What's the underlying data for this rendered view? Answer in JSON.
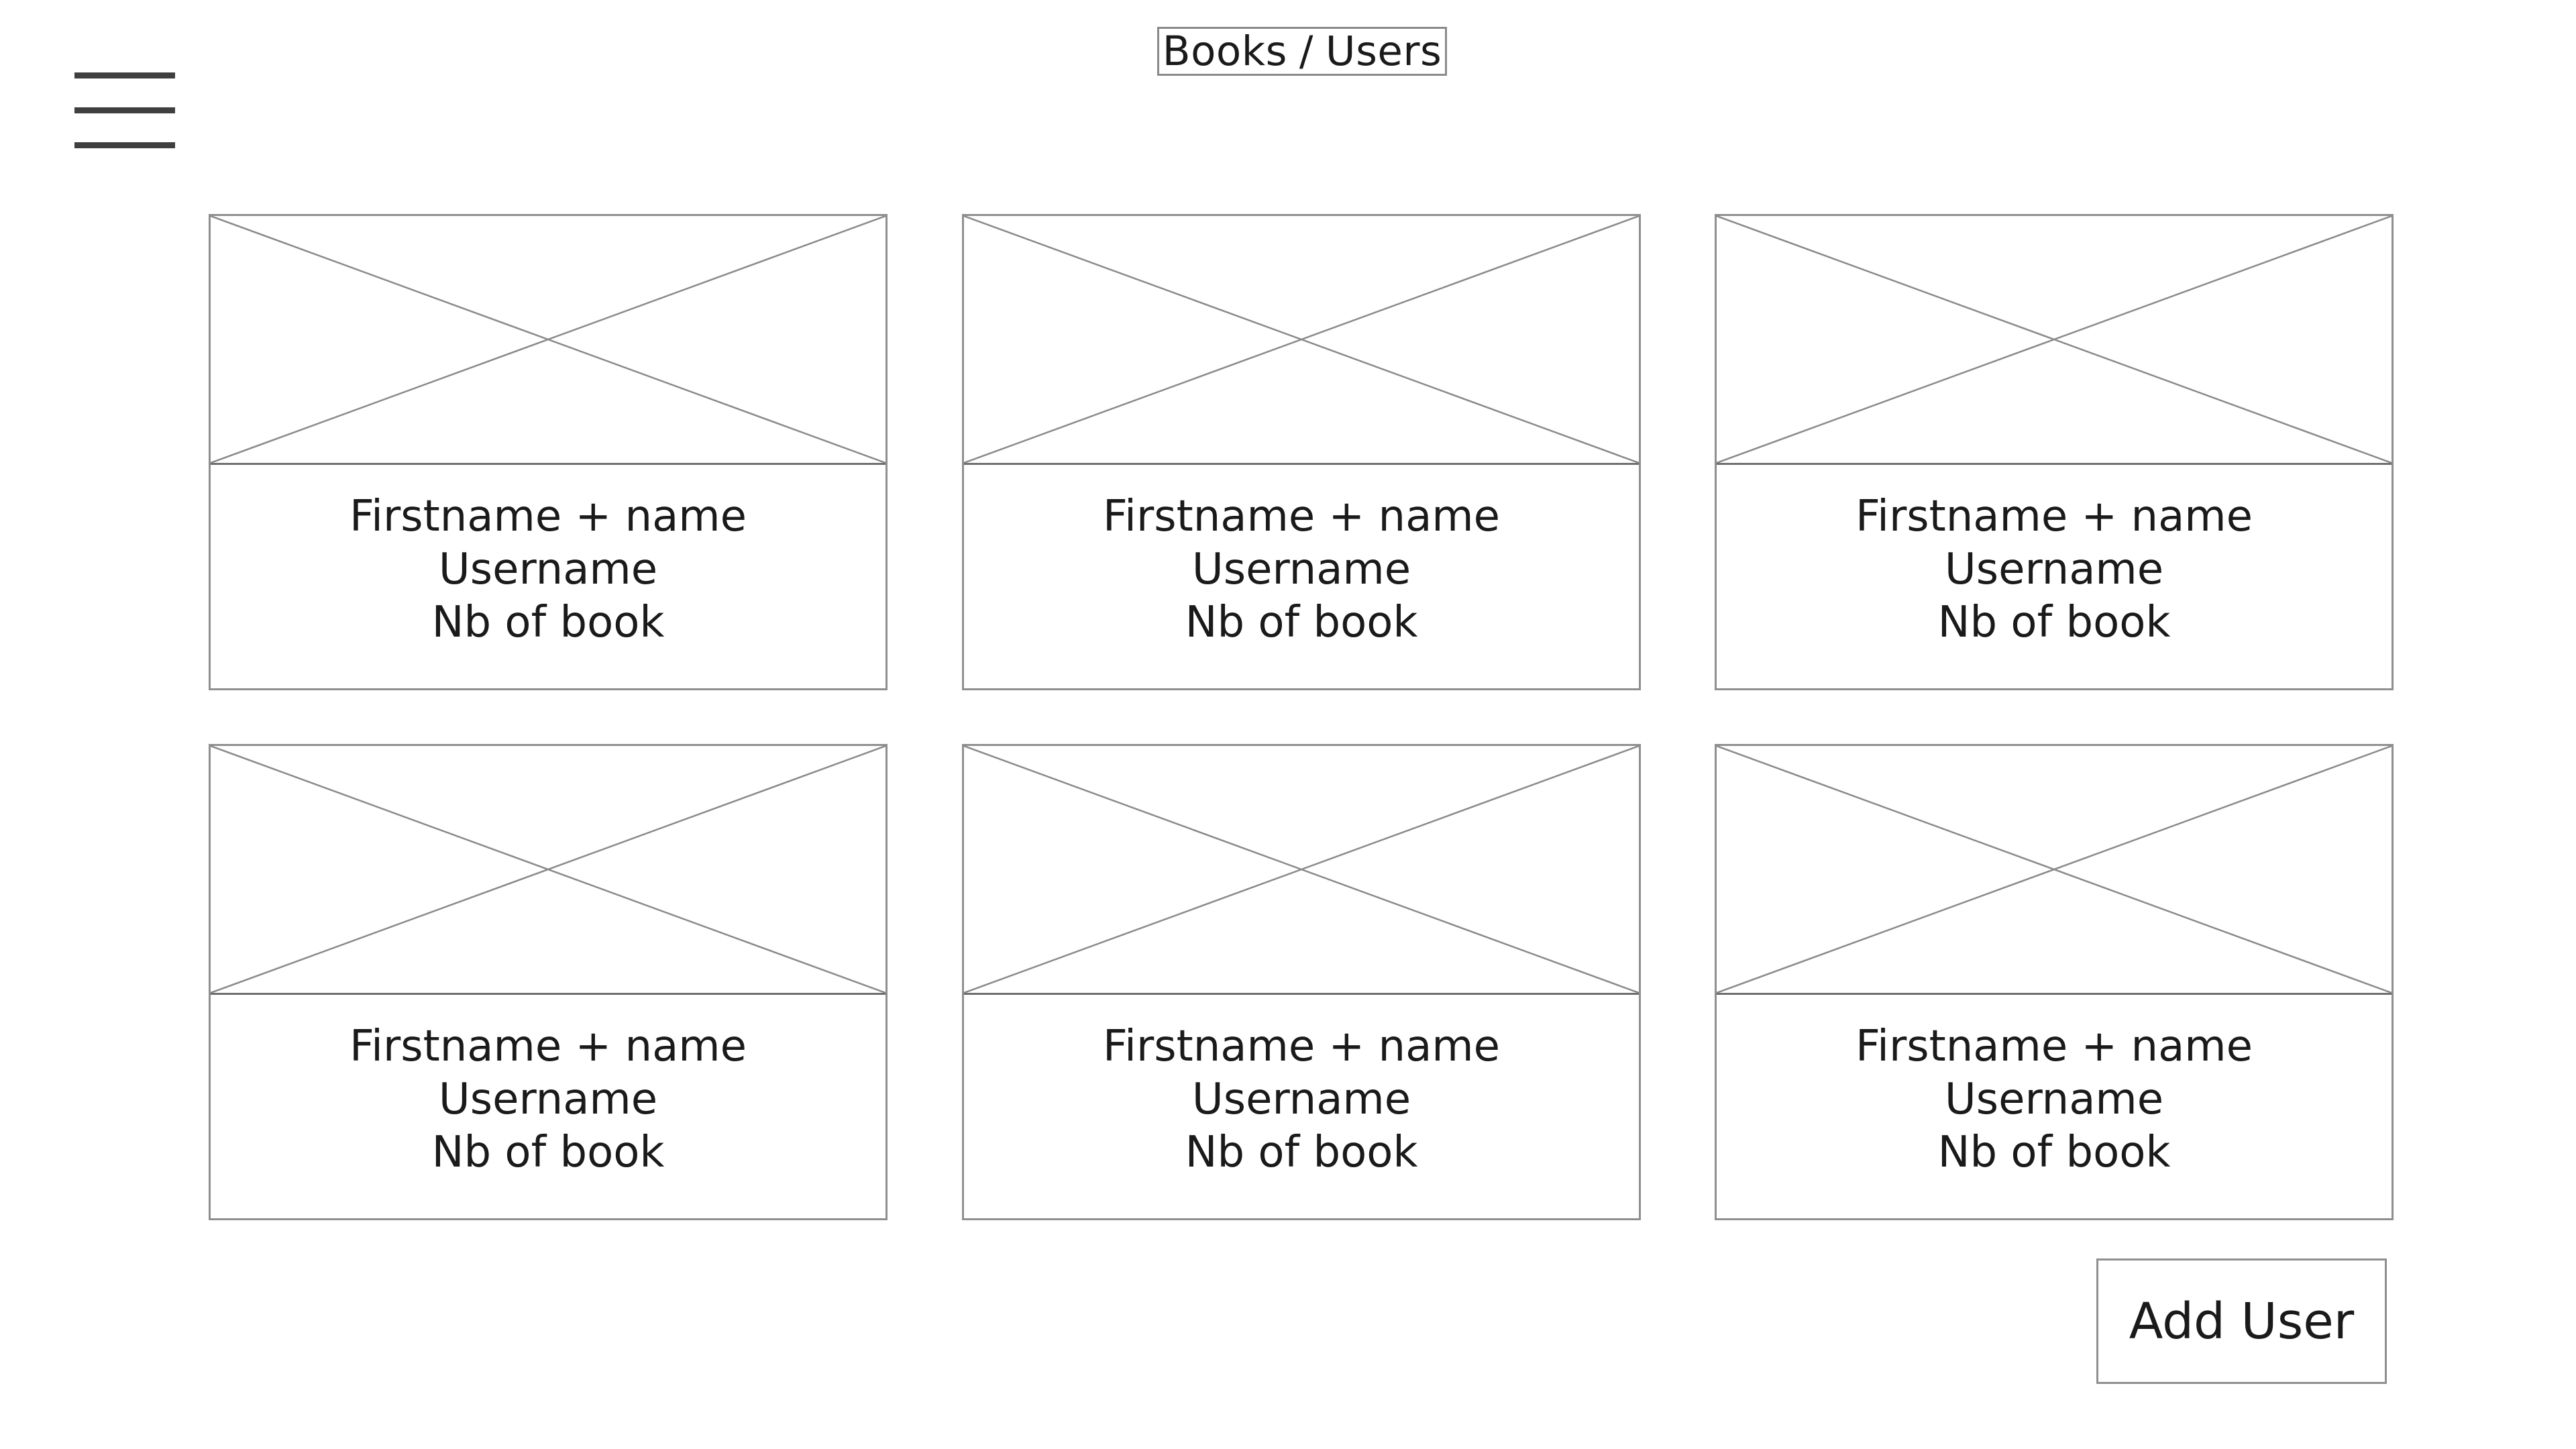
{
  "header": {
    "menu_icon": "hamburger-menu-icon",
    "nav": {
      "books_label": "Books",
      "separator": "/",
      "users_label": "Users"
    }
  },
  "users": [
    {
      "image_icon": "image-placeholder-icon",
      "fullname": "Firstname + name",
      "username": "Username",
      "book_count": "Nb of book"
    },
    {
      "image_icon": "image-placeholder-icon",
      "fullname": "Firstname + name",
      "username": "Username",
      "book_count": "Nb of book"
    },
    {
      "image_icon": "image-placeholder-icon",
      "fullname": "Firstname + name",
      "username": "Username",
      "book_count": "Nb of book"
    },
    {
      "image_icon": "image-placeholder-icon",
      "fullname": "Firstname + name",
      "username": "Username",
      "book_count": "Nb of book"
    },
    {
      "image_icon": "image-placeholder-icon",
      "fullname": "Firstname + name",
      "username": "Username",
      "book_count": "Nb of book"
    },
    {
      "image_icon": "image-placeholder-icon",
      "fullname": "Firstname + name",
      "username": "Username",
      "book_count": "Nb of book"
    }
  ],
  "actions": {
    "add_user_label": "Add User"
  },
  "colors": {
    "border": "#8f8f8f",
    "placeholder_lines": "#8a8a8a",
    "menu_bars": "#3f3f3f",
    "text": "#1a1a1a"
  }
}
